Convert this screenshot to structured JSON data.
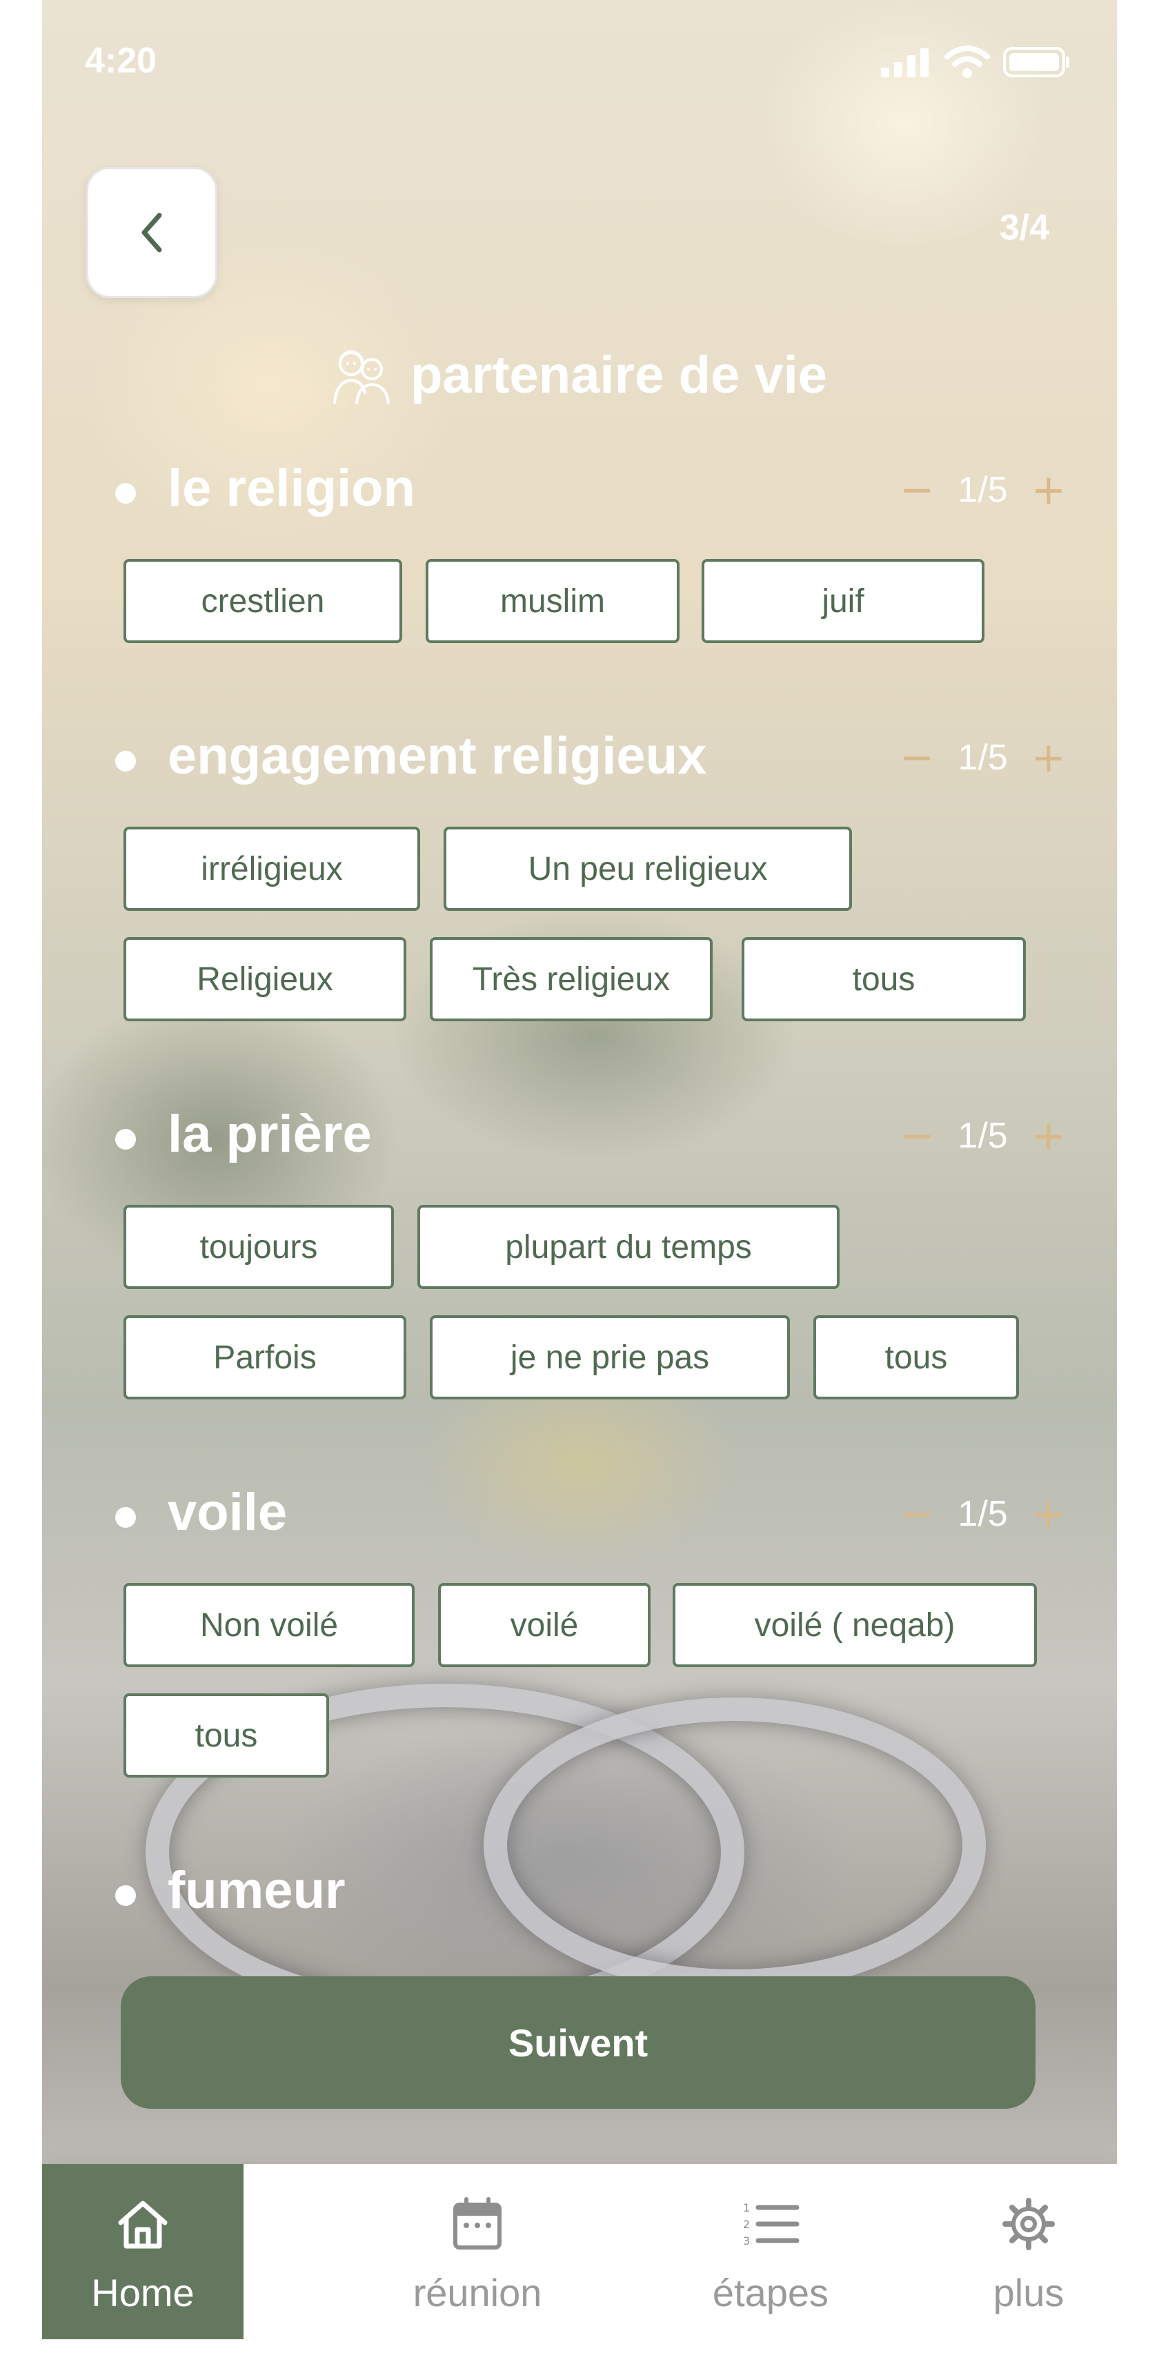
{
  "status_bar": {
    "time": "4:20"
  },
  "header": {
    "page_indicator": "3/4",
    "title": "partenaire de vie",
    "title_icon": "couple-icon"
  },
  "sections": [
    {
      "title": "le religion",
      "count": "1/5",
      "options": [
        "crestlien",
        "muslim",
        "juif"
      ]
    },
    {
      "title": "engagement religieux",
      "count": "1/5",
      "options": [
        "irréligieux",
        "Un peu religieux",
        "Religieux",
        "Très religieux",
        "tous"
      ]
    },
    {
      "title": "la prière",
      "count": "1/5",
      "options": [
        "toujours",
        "plupart du temps",
        "Parfois",
        "je ne prie pas",
        "tous"
      ]
    },
    {
      "title": "voile",
      "count": "1/5",
      "options": [
        "Non voilé",
        "voilé",
        "voilé ( neqab)",
        "tous"
      ]
    },
    {
      "title": "fumeur"
    }
  ],
  "counter_symbols": {
    "minus": "−",
    "plus": "+"
  },
  "submit_label": "Suivent",
  "tabbar": {
    "items": [
      {
        "label": "Home",
        "icon": "home-icon",
        "active": true
      },
      {
        "label": "réunion",
        "icon": "calendar-icon",
        "active": false
      },
      {
        "label": "étapes",
        "icon": "list-icon",
        "active": false
      },
      {
        "label": "plus",
        "icon": "gear-icon",
        "active": false
      }
    ]
  },
  "colors": {
    "accent": "#64785f",
    "chip_border": "#5f7a5f",
    "counter": "#d9b98a"
  }
}
